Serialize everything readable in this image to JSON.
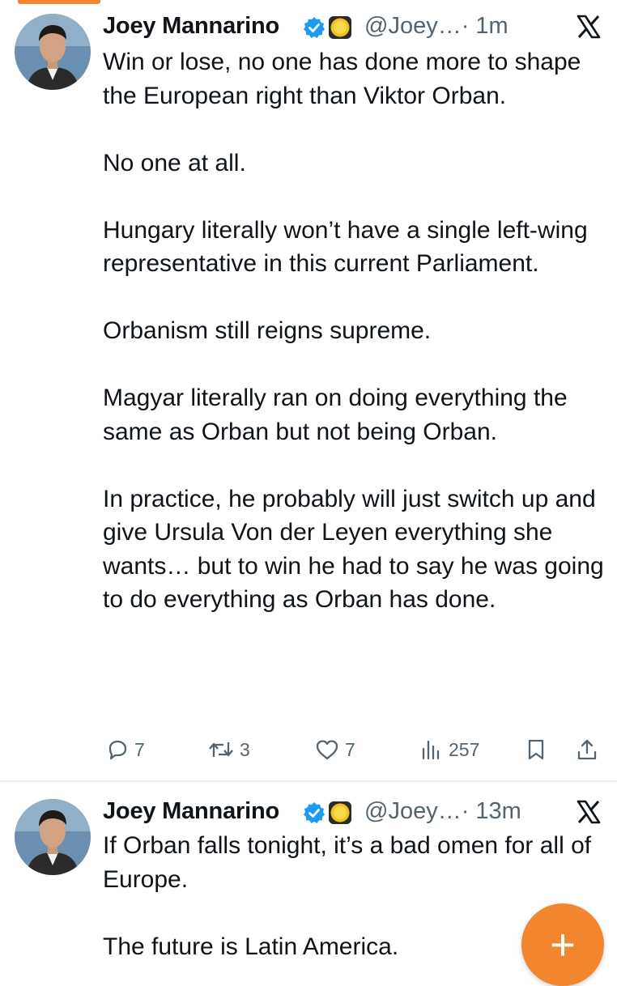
{
  "tweets": [
    {
      "author_name": "Joey Mannarino",
      "handle": "@Joey…",
      "time": "· 1m",
      "paragraphs": [
        "Win or lose, no one has done more to shape the European right than Viktor Orban.",
        "No one at all.",
        "Hungary literally won’t have a single left-wing representative in this current Parliament.",
        "Orbanism still reigns supreme.",
        "Magyar literally ran on doing everything the same as Orban but not being Orban.",
        "In practice, he probably will just switch up and give Ursula Von der Leyen everything she wants… but to win he had to say he was going to do everything as Orban has done."
      ],
      "replies": "7",
      "reposts": "3",
      "likes": "7",
      "views": "257"
    },
    {
      "author_name": "Joey Mannarino",
      "handle": "@Joey…",
      "time": "· 13m",
      "paragraphs": [
        "If Orban falls tonight, it’s a bad omen for all of Europe.",
        "The future is Latin America."
      ]
    }
  ],
  "fab_label": "+",
  "colors": {
    "accent": "#f2862e",
    "verified": "#1d9bf0",
    "muted": "#536471",
    "text": "#0f1419"
  },
  "icons": [
    "verified-badge-icon",
    "coin-emoji-icon",
    "x-logo-icon",
    "reply-icon",
    "repost-icon",
    "like-icon",
    "views-icon",
    "bookmark-icon",
    "share-icon",
    "compose-plus-icon"
  ]
}
